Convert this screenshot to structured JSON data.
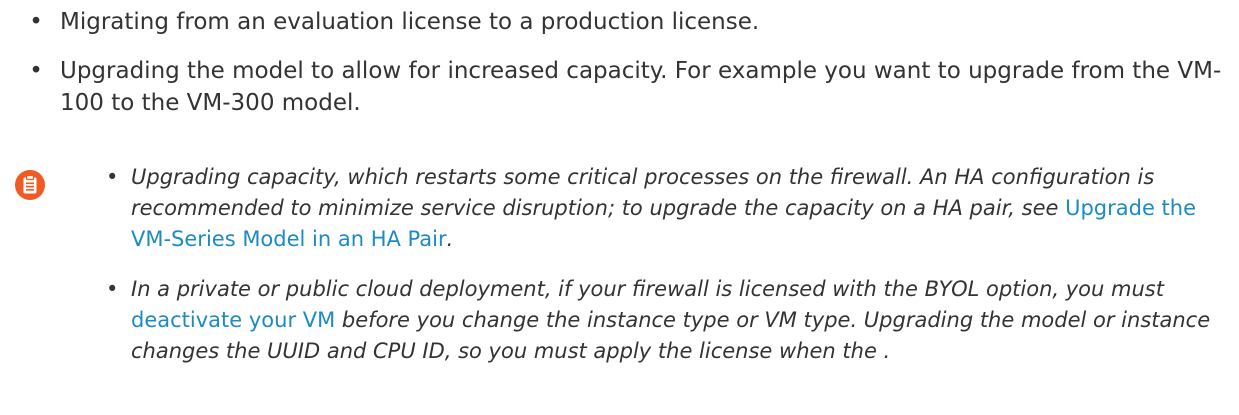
{
  "bullets": [
    {
      "text": "Migrating from an evaluation license to a production license."
    },
    {
      "text": "Upgrading the model to allow for increased capacity. For example you want to upgrade from the VM-100 to the VM-300 model."
    }
  ],
  "note": {
    "icon": "clipboard-note-icon",
    "icon_color": "#f15a22",
    "link_color": "#1b8bc4",
    "items": [
      {
        "text_before": "Upgrading capacity, which restarts some critical processes on the firewall. An HA configuration is recommended to minimize service disruption; to upgrade the capacity on a HA pair, see ",
        "link": "Upgrade the VM-Series Model in an HA Pair",
        "text_after": "."
      },
      {
        "text_before": "In a private or public cloud deployment, if your firewall is licensed with the BYOL option, you must ",
        "link": "deactivate your VM",
        "text_after": " before you change the instance type or VM type. Upgrading the model or instance changes the UUID and CPU ID, so you must apply the license when the ."
      }
    ]
  }
}
